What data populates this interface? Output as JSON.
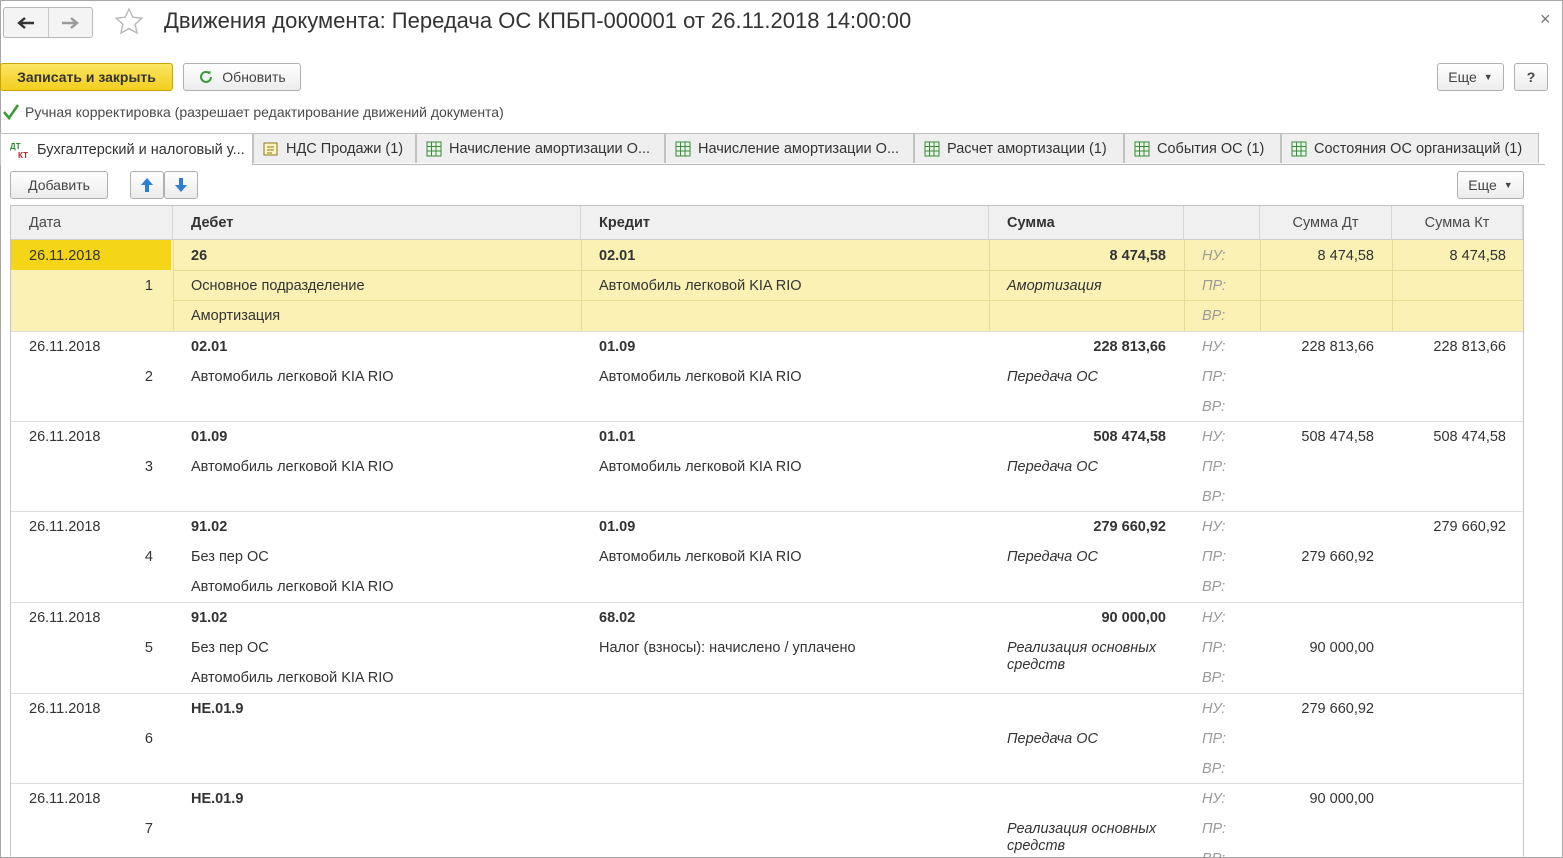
{
  "window": {
    "title": "Движения документа: Передача ОС КПБП-000001 от 26.11.2018 14:00:00",
    "close_glyph": "×"
  },
  "toolbar": {
    "save_close_label": "Записать и закрыть",
    "refresh_label": "Обновить",
    "more_label": "Еще",
    "help_label": "?"
  },
  "manual_correction": {
    "checked": true,
    "label": "Ручная корректировка (разрешает редактирование движений документа)"
  },
  "tabs": [
    {
      "label": "Бухгалтерский и налоговый у...",
      "icon": "dt-kt-icon",
      "active": true
    },
    {
      "label": "НДС Продажи (1)",
      "icon": "register-icon",
      "active": false
    },
    {
      "label": "Начисление амортизации О...",
      "icon": "table-icon",
      "active": false
    },
    {
      "label": "Начисление амортизации О...",
      "icon": "table-icon",
      "active": false
    },
    {
      "label": "Расчет амортизации (1)",
      "icon": "table-icon",
      "active": false
    },
    {
      "label": "События ОС (1)",
      "icon": "table-icon",
      "active": false
    },
    {
      "label": "Состояния ОС организаций (1)",
      "icon": "table-icon",
      "active": false
    }
  ],
  "table_toolbar": {
    "add_label": "Добавить",
    "more_label": "Еще"
  },
  "table": {
    "headers": {
      "date": "Дата",
      "debit": "Дебет",
      "credit": "Кредит",
      "sum": "Сумма",
      "sum_dt": "Сумма Дт",
      "sum_kt": "Сумма Кт"
    },
    "tags": [
      "НУ:",
      "ПР:",
      "ВР:"
    ],
    "rows": [
      {
        "date": "26.11.2018",
        "num": "1",
        "debit": [
          "26",
          "Основное подразделение",
          "Амортизация"
        ],
        "credit": [
          "02.01",
          "Автомобиль легковой KIA RIO",
          ""
        ],
        "sum": "8 474,58",
        "content": "Амортизация",
        "dt": [
          "8 474,58",
          "",
          ""
        ],
        "kt": [
          "8 474,58",
          "",
          ""
        ],
        "selected": true
      },
      {
        "date": "26.11.2018",
        "num": "2",
        "debit": [
          "02.01",
          "Автомобиль легковой KIA RIO",
          ""
        ],
        "credit": [
          "01.09",
          "Автомобиль легковой KIA RIO",
          ""
        ],
        "sum": "228 813,66",
        "content": "Передача ОС",
        "dt": [
          "228 813,66",
          "",
          ""
        ],
        "kt": [
          "228 813,66",
          "",
          ""
        ],
        "selected": false
      },
      {
        "date": "26.11.2018",
        "num": "3",
        "debit": [
          "01.09",
          "Автомобиль легковой KIA RIO",
          ""
        ],
        "credit": [
          "01.01",
          "Автомобиль легковой KIA RIO",
          ""
        ],
        "sum": "508 474,58",
        "content": "Передача ОС",
        "dt": [
          "508 474,58",
          "",
          ""
        ],
        "kt": [
          "508 474,58",
          "",
          ""
        ],
        "selected": false
      },
      {
        "date": "26.11.2018",
        "num": "4",
        "debit": [
          "91.02",
          "Без пер ОС",
          "Автомобиль легковой KIA RIO"
        ],
        "credit": [
          "01.09",
          "Автомобиль легковой KIA RIO",
          ""
        ],
        "sum": "279 660,92",
        "content": "Передача ОС",
        "dt": [
          "",
          "279 660,92",
          ""
        ],
        "kt": [
          "279 660,92",
          "",
          ""
        ],
        "selected": false
      },
      {
        "date": "26.11.2018",
        "num": "5",
        "debit": [
          "91.02",
          "Без пер ОС",
          "Автомобиль легковой KIA RIO"
        ],
        "credit": [
          "68.02",
          "Налог (взносы): начислено / уплачено",
          ""
        ],
        "sum": "90 000,00",
        "content": "Реализация основных средств",
        "dt": [
          "",
          "90 000,00",
          ""
        ],
        "kt": [
          "",
          "",
          ""
        ],
        "selected": false
      },
      {
        "date": "26.11.2018",
        "num": "6",
        "debit": [
          "НЕ.01.9",
          "",
          ""
        ],
        "credit": [
          "",
          "",
          ""
        ],
        "sum": "",
        "content": "Передача ОС",
        "dt": [
          "279 660,92",
          "",
          ""
        ],
        "kt": [
          "",
          "",
          ""
        ],
        "selected": false
      },
      {
        "date": "26.11.2018",
        "num": "7",
        "debit": [
          "НЕ.01.9",
          "",
          ""
        ],
        "credit": [
          "",
          "",
          ""
        ],
        "sum": "",
        "content": "Реализация основных средств",
        "dt": [
          "90 000,00",
          "",
          ""
        ],
        "kt": [
          "",
          "",
          ""
        ],
        "selected": false
      }
    ]
  },
  "colors": {
    "accent_yellow": "#f5d518",
    "selected_row": "#fbf1b5",
    "check_green": "#3a9a3a",
    "arrow_blue": "#2a7fd4"
  }
}
